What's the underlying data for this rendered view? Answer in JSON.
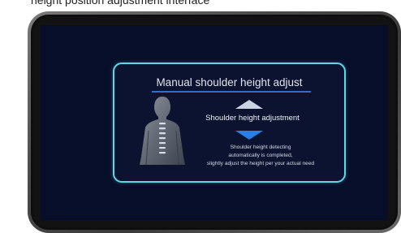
{
  "caption": "height position adjustment interface",
  "dialog": {
    "title": "Manual shoulder height adjust",
    "adjust_label": "Shoulder height adjustment",
    "hint_lines": [
      "Shoulder height detecting",
      "automatically is completed,",
      "slightly adjust the height per your actual need"
    ]
  },
  "icons": {
    "body": "human-back-silhouette-icon",
    "up": "arrow-up-icon",
    "down": "arrow-down-icon"
  },
  "colors": {
    "screen_background": "#070e2a",
    "dialog_border": "#61d6ea",
    "title_underline": "#2a6fd6",
    "arrow_up": "#c9d3e3",
    "arrow_down": "#2a7fe0"
  }
}
